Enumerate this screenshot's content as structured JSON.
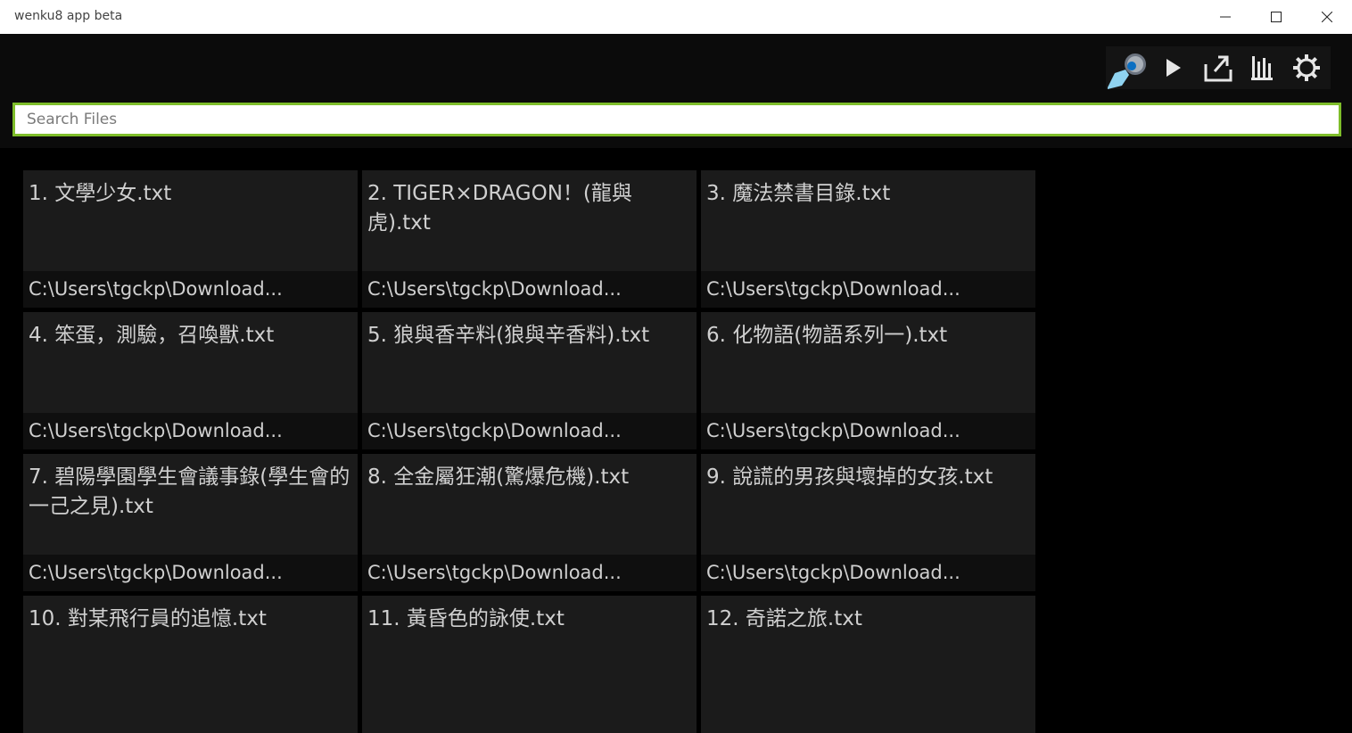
{
  "window": {
    "title": "wenku8 app beta",
    "controls": [
      "minimize-icon",
      "maximize-icon",
      "close-icon"
    ]
  },
  "toolbar": {
    "buttons": [
      {
        "name": "magnifier-icon"
      },
      {
        "name": "play-icon"
      },
      {
        "name": "share-icon"
      },
      {
        "name": "library-icon"
      },
      {
        "name": "gear-icon"
      }
    ]
  },
  "search": {
    "placeholder": "Search Files",
    "value": ""
  },
  "files": [
    {
      "name": "1. 文學少女.txt",
      "path": "C:\\Users\\tgckp\\Download..."
    },
    {
      "name": "2. TIGER×DRAGON！(龍與虎).txt",
      "path": "C:\\Users\\tgckp\\Download..."
    },
    {
      "name": "3. 魔法禁書目錄.txt",
      "path": "C:\\Users\\tgckp\\Download..."
    },
    {
      "name": "4. 笨蛋，測驗，召喚獸.txt",
      "path": "C:\\Users\\tgckp\\Download..."
    },
    {
      "name": "5. 狼與香辛料(狼與辛香料).txt",
      "path": "C:\\Users\\tgckp\\Download..."
    },
    {
      "name": "6. 化物語(物語系列一).txt",
      "path": "C:\\Users\\tgckp\\Download..."
    },
    {
      "name": "7. 碧陽學園學生會議事錄(學生會的一己之見).txt",
      "path": "C:\\Users\\tgckp\\Download..."
    },
    {
      "name": "8. 全金屬狂潮(驚爆危機).txt",
      "path": "C:\\Users\\tgckp\\Download..."
    },
    {
      "name": "9. 說謊的男孩與壞掉的女孩.txt",
      "path": "C:\\Users\\tgckp\\Download..."
    },
    {
      "name": "10. 對某飛行員的追憶.txt",
      "path": ""
    },
    {
      "name": "11. 黃昏色的詠使.txt",
      "path": ""
    },
    {
      "name": "12. 奇諾之旅.txt",
      "path": ""
    }
  ],
  "colors": {
    "accent": "#7ebd2a",
    "tile": "#1b1b1b",
    "tile_footer": "#0f0f0f",
    "text": "#d0d0d0"
  }
}
